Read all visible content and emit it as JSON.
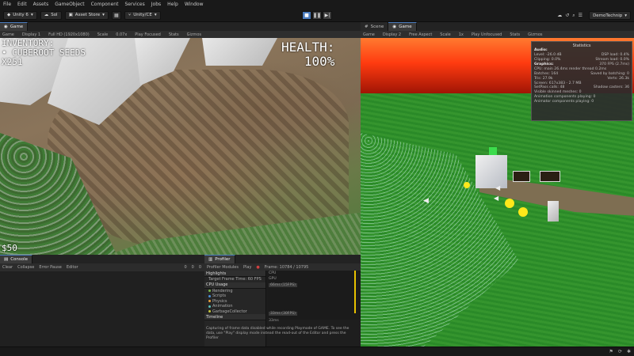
{
  "menu": [
    "File",
    "Edit",
    "Assets",
    "GameObject",
    "Component",
    "Services",
    "Jobs",
    "Help",
    "Window"
  ],
  "toolbar": {
    "account": "Unity 6",
    "add": "Sol",
    "asset_store": "Asset Store",
    "version_control": "Unity/CE",
    "layout": "DemoTechnip"
  },
  "game": {
    "tab_label": "Game",
    "subbar": [
      "Game",
      "Display 1",
      "Full HD (1920x1080)",
      "Scale",
      "0.07x",
      "Play Focused",
      "Stats",
      "Gizmos"
    ],
    "hud": {
      "inventory_title": "INVENTORY:",
      "inventory_item": "• CUBEROOT SEEDS",
      "inventory_count": "X251",
      "health_label": "HEALTH:",
      "health_value": "100%",
      "money": "$50"
    }
  },
  "scene": {
    "tab_scene": "Scene",
    "tab_game": "Game",
    "subbar": [
      "Game",
      "Display 2",
      "Free Aspect",
      "Scale",
      "1x",
      "Play Unfocused",
      "Stats",
      "Gizmos"
    ],
    "stats": {
      "title": "Statistics",
      "audio_head": "Audio:",
      "audio_level": "Level: -26.0 dB",
      "audio_dsp": "DSP load: 0.4%",
      "audio_clipping": "Clipping: 0.0%",
      "audio_stream": "Stream load: 0.0%",
      "graphics_head": "Graphics:",
      "graphics_fps": "370 FPS (2.7ms)",
      "cpu": "CPU: main 26.4ms  render thread 0.2ms",
      "batches": "Batches: 164",
      "saved_batching": "Saved by batching: 0",
      "tris": "Tris: 27.9k",
      "verts": "Verts: 26.3k",
      "screen": "Screen: 617x383 - 2.7 MB",
      "setpass": "SetPass calls: 48",
      "shadow_casters": "Shadow casters: 36",
      "skinned": "Visible skinned meshes: 0",
      "anim_components": "Animation components playing: 0",
      "animator_components": "Animator components playing: 0"
    }
  },
  "console": {
    "tab_label": "Console",
    "toolbar": [
      "Clear",
      "Collapse",
      "Error Pause",
      "Editor",
      "0",
      "0",
      "0"
    ]
  },
  "profiler": {
    "tab_label": "Profiler",
    "toolbar": [
      "Profiler Modules",
      "Play",
      "Frame: 10784 / 10795"
    ],
    "highlights": "Highlights",
    "target": "Target Frame Time: 60 FPS",
    "cpu_usage": "CPU Usage",
    "items": [
      {
        "label": "Rendering",
        "color": "#7ab648"
      },
      {
        "label": "Scripts",
        "color": "#4a90d9"
      },
      {
        "label": "Physics",
        "color": "#e8a23c"
      },
      {
        "label": "Animation",
        "color": "#58c0b8"
      },
      {
        "label": "GarbageCollector",
        "color": "#c6c63c"
      }
    ],
    "timeline": "Timeline",
    "chart_labels": {
      "cpu": "CPU",
      "gpu": "GPU",
      "top_ms": "66ms (15FPS)",
      "bottom_ms": "33ms (30FPS)",
      "timeline_ms": "33ms"
    },
    "note": "Capturing of frame data disabled while recording Playmode of GAME. To see the data, use \"Play\" display mode instead the read-out of the Editor and press the Profiler"
  }
}
